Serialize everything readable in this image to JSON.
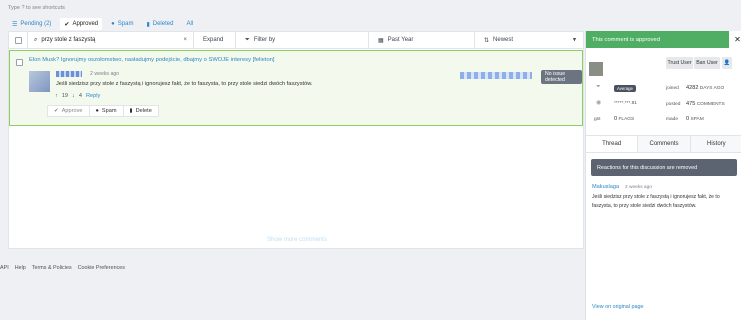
{
  "hint": "Type  ?  to see shortcuts",
  "tabs": [
    {
      "label": "Pending (2)",
      "icon": "list-icon"
    },
    {
      "label": "Approved",
      "icon": "check-icon"
    },
    {
      "label": "Spam",
      "icon": "alert-icon"
    },
    {
      "label": "Deleted",
      "icon": "trash-icon"
    },
    {
      "label": "All",
      "icon": ""
    }
  ],
  "toolbar": {
    "search_value": "przy stole z faszystą",
    "expand": "Expand",
    "filter": "Filter by",
    "period": "Past Year",
    "sort": "Newest"
  },
  "comment": {
    "title": "Elon Musk? Ignorujmy oszołomstwo, nasładujmy podejście, dbajmy o SWOJE interesy [felieton]",
    "time": "2 weeks ago",
    "body": "Jeśli siedzisz przy stole z faszystą i ignorujesz fakt, że to faszysta, to przy stole siedzi dwóch faszystów.",
    "upvotes": "19",
    "downvotes": "4",
    "reply": "Reply",
    "badge": "No issue detected",
    "actions": {
      "approve": "Approve",
      "spam": "Spam",
      "delete": "Delete"
    }
  },
  "show_more": "Show more comments",
  "footer": [
    "API",
    "Help",
    "Terms & Policies",
    "Cookie Preferences"
  ],
  "panel": {
    "header": "This comment is approved",
    "trust_user": "Trust User",
    "ban_user": "Ban User",
    "reputation": "Average",
    "ip": "*****.***.81",
    "joined_label": "joined",
    "joined_value": "4282",
    "joined_unit": "DAYS AGO",
    "posted_label": "posted",
    "posted_value": "475",
    "posted_unit": "COMMENTS",
    "flags_value": "0",
    "flags_label": "FLAGS",
    "made_label": "made",
    "made_value": "0",
    "made_unit": "SPAM",
    "gst_label": "gst",
    "tabs": [
      "Thread",
      "Comments",
      "History"
    ],
    "notice": "Reactions for this discussion are removed",
    "thread_author": "Makuslaga",
    "thread_time": "2 weeks ago",
    "thread_body": "Jeśli siedzisz przy stole z faszystą i ignorujesz fakt, że to faszysta, to przy stole siedzi dwóch faszystów.",
    "view_link": "View on original page"
  },
  "colors": {
    "approved": "#4fae64",
    "link": "#2d88c9",
    "row_bg": "#f3f9ec",
    "row_border": "#8bd05f"
  }
}
